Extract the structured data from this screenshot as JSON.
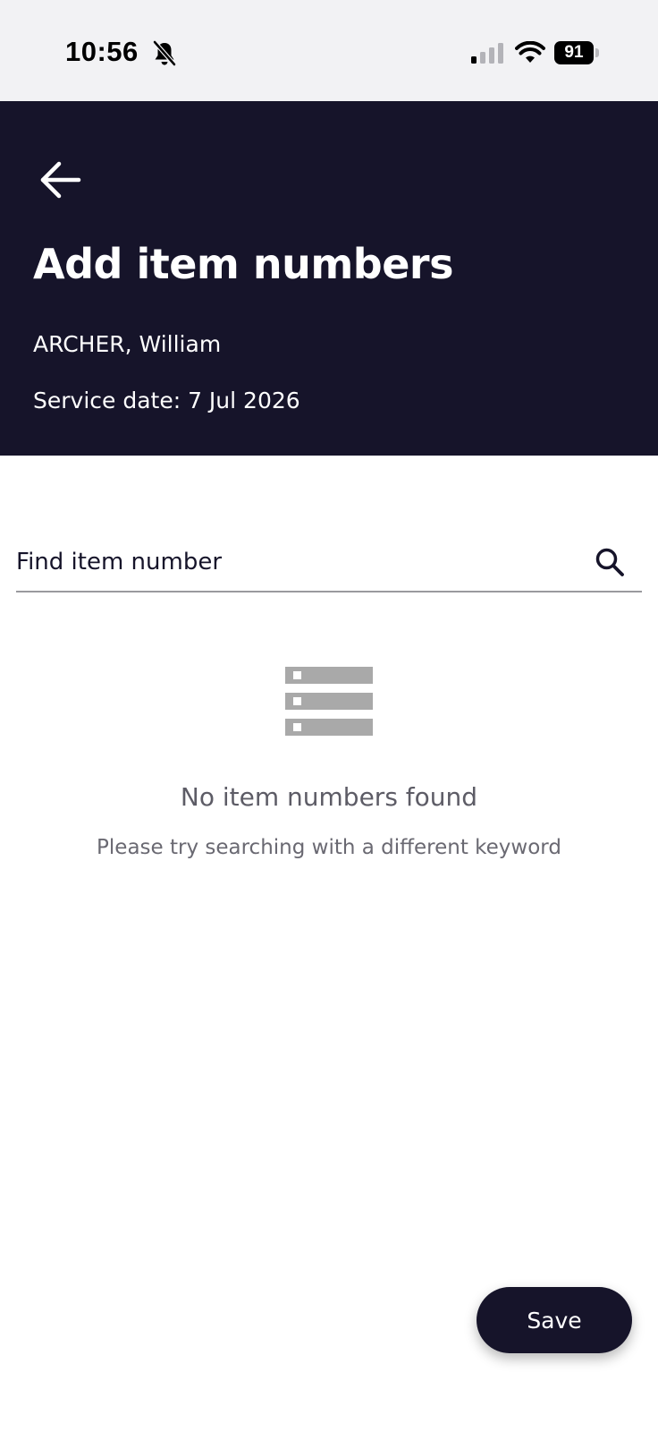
{
  "status_bar": {
    "time": "10:56",
    "battery": "91",
    "icons": [
      "bell-off-icon",
      "signal-icon",
      "wifi-icon",
      "battery-icon"
    ]
  },
  "header": {
    "back_icon": "arrow-left-icon",
    "title": "Add item numbers",
    "patient_name": "ARCHER, William",
    "service_date": "Service date: 7 Jul 2026"
  },
  "search": {
    "placeholder": "Find item number",
    "value": "",
    "icon": "search-icon"
  },
  "empty_state": {
    "icon": "list-icon",
    "title": "No item numbers found",
    "subtitle": "Please try searching with a different keyword"
  },
  "actions": {
    "save_label": "Save"
  },
  "colors": {
    "header_bg": "#16142a",
    "status_bar_bg": "#f2f2f4",
    "button_bg": "#16142a",
    "empty_icon": "#a9a9a9"
  }
}
